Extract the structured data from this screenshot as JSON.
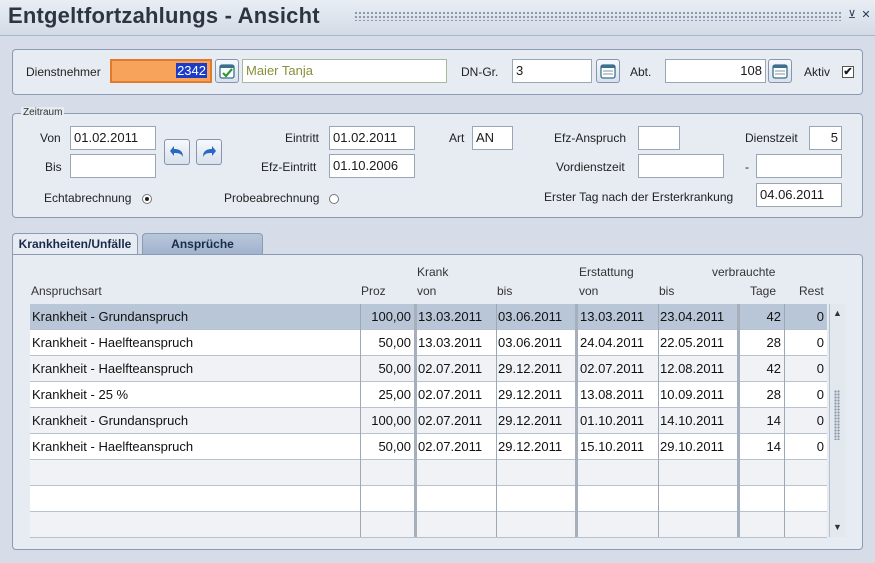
{
  "window": {
    "title": "Entgeltfortzahlungs - Ansicht",
    "minimize_glyph": "⊻",
    "close_glyph": "✕"
  },
  "employee": {
    "label": "Dienstnehmer",
    "number": "2342",
    "name": "Maier Tanja",
    "dn_gr_label": "DN-Gr.",
    "dn_gr_value": "3",
    "abt_label": "Abt.",
    "abt_value": "108",
    "aktiv_label": "Aktiv",
    "aktiv_checked": "✔"
  },
  "zeitraum": {
    "legend": "Zeitraum",
    "von_label": "Von",
    "von_value": "01.02.2011",
    "bis_label": "Bis",
    "bis_value": "",
    "eintritt_label": "Eintritt",
    "eintritt_value": "01.02.2011",
    "efz_eintritt_label": "Efz-Eintritt",
    "efz_eintritt_value": "01.10.2006",
    "art_label": "Art",
    "art_value": "AN",
    "efz_anspruch_label": "Efz-Anspruch",
    "efz_anspruch_value": "",
    "dienstzeit_label": "Dienstzeit",
    "dienstzeit_value": "5",
    "vordienstzeit_label": "Vordienstzeit",
    "vordienstzeit_value": "",
    "dash": "-",
    "vordienstzeit_value2": "",
    "echtabrechnung_label": "Echtabrechnung",
    "probeabrechnung_label": "Probeabrechnung",
    "erster_tag_label": "Erster Tag nach der Ersterkrankung",
    "erster_tag_value": "04.06.2011"
  },
  "tabs": [
    {
      "label": "Krankheiten/Unfälle",
      "active": true
    },
    {
      "label": "Ansprüche",
      "active": false
    }
  ],
  "table": {
    "headers": {
      "anspruchsart": "Anspruchsart",
      "proz": "Proz",
      "krank": "Krank",
      "krank_von": "von",
      "krank_bis": "bis",
      "erstattung": "Erstattung",
      "erst_von": "von",
      "erst_bis": "bis",
      "verbrauchte": "verbrauchte",
      "tage": "Tage",
      "rest": "Rest"
    },
    "rows": [
      {
        "art": "Krankheit - Grundanspruch",
        "proz": "100,00",
        "krank_von": "13.03.2011",
        "krank_bis": "03.06.2011",
        "erst_von": "13.03.2011",
        "erst_bis": "23.04.2011",
        "tage": "42",
        "rest": "0"
      },
      {
        "art": "Krankheit - Haelfteanspruch",
        "proz": "50,00",
        "krank_von": "13.03.2011",
        "krank_bis": "03.06.2011",
        "erst_von": "24.04.2011",
        "erst_bis": "22.05.2011",
        "tage": "28",
        "rest": "0"
      },
      {
        "art": "Krankheit - Haelfteanspruch",
        "proz": "50,00",
        "krank_von": "02.07.2011",
        "krank_bis": "29.12.2011",
        "erst_von": "02.07.2011",
        "erst_bis": "12.08.2011",
        "tage": "42",
        "rest": "0"
      },
      {
        "art": "Krankheit - 25 %",
        "proz": "25,00",
        "krank_von": "02.07.2011",
        "krank_bis": "29.12.2011",
        "erst_von": "13.08.2011",
        "erst_bis": "10.09.2011",
        "tage": "28",
        "rest": "0"
      },
      {
        "art": "Krankheit - Grundanspruch",
        "proz": "100,00",
        "krank_von": "02.07.2011",
        "krank_bis": "29.12.2011",
        "erst_von": "01.10.2011",
        "erst_bis": "14.10.2011",
        "tage": "14",
        "rest": "0"
      },
      {
        "art": "Krankheit - Haelfteanspruch",
        "proz": "50,00",
        "krank_von": "02.07.2011",
        "krank_bis": "29.12.2011",
        "erst_von": "15.10.2011",
        "erst_bis": "29.10.2011",
        "tage": "14",
        "rest": "0"
      },
      {
        "art": "",
        "proz": "",
        "krank_von": "",
        "krank_bis": "",
        "erst_von": "",
        "erst_bis": "",
        "tage": "",
        "rest": ""
      },
      {
        "art": "",
        "proz": "",
        "krank_von": "",
        "krank_bis": "",
        "erst_von": "",
        "erst_bis": "",
        "tage": "",
        "rest": ""
      },
      {
        "art": "",
        "proz": "",
        "krank_von": "",
        "krank_bis": "",
        "erst_von": "",
        "erst_bis": "",
        "tage": "",
        "rest": ""
      }
    ],
    "scroll_up": "▲",
    "scroll_down": "▼"
  },
  "icons": {
    "lookup": "check-list-icon",
    "calendar": "calendar-icon",
    "prev": "arrow-left-icon",
    "next": "arrow-right-icon"
  },
  "colors": {
    "accent_orange": "#f7a35c",
    "selection_blue": "#1a3cc8",
    "selected_row": "#b9c6d8",
    "panel_bg": "#e7ecf3"
  }
}
